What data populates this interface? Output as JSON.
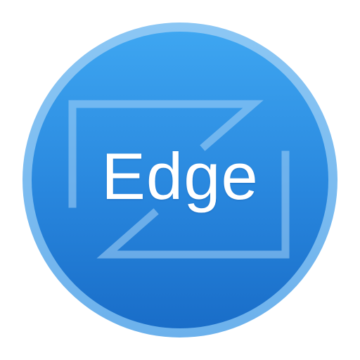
{
  "app": {
    "name": "Edge"
  },
  "colors": {
    "outer_ring": "#7fbdf1",
    "disc_top": "#3aa2ef",
    "disc_bottom": "#1a6fcb",
    "frame_stroke": "#9fd0f7",
    "text": "#ffffff",
    "background": "#ffffff"
  },
  "icon": {
    "name": "edge-app-icon",
    "frame_icon": "bracket-frame-icon"
  }
}
